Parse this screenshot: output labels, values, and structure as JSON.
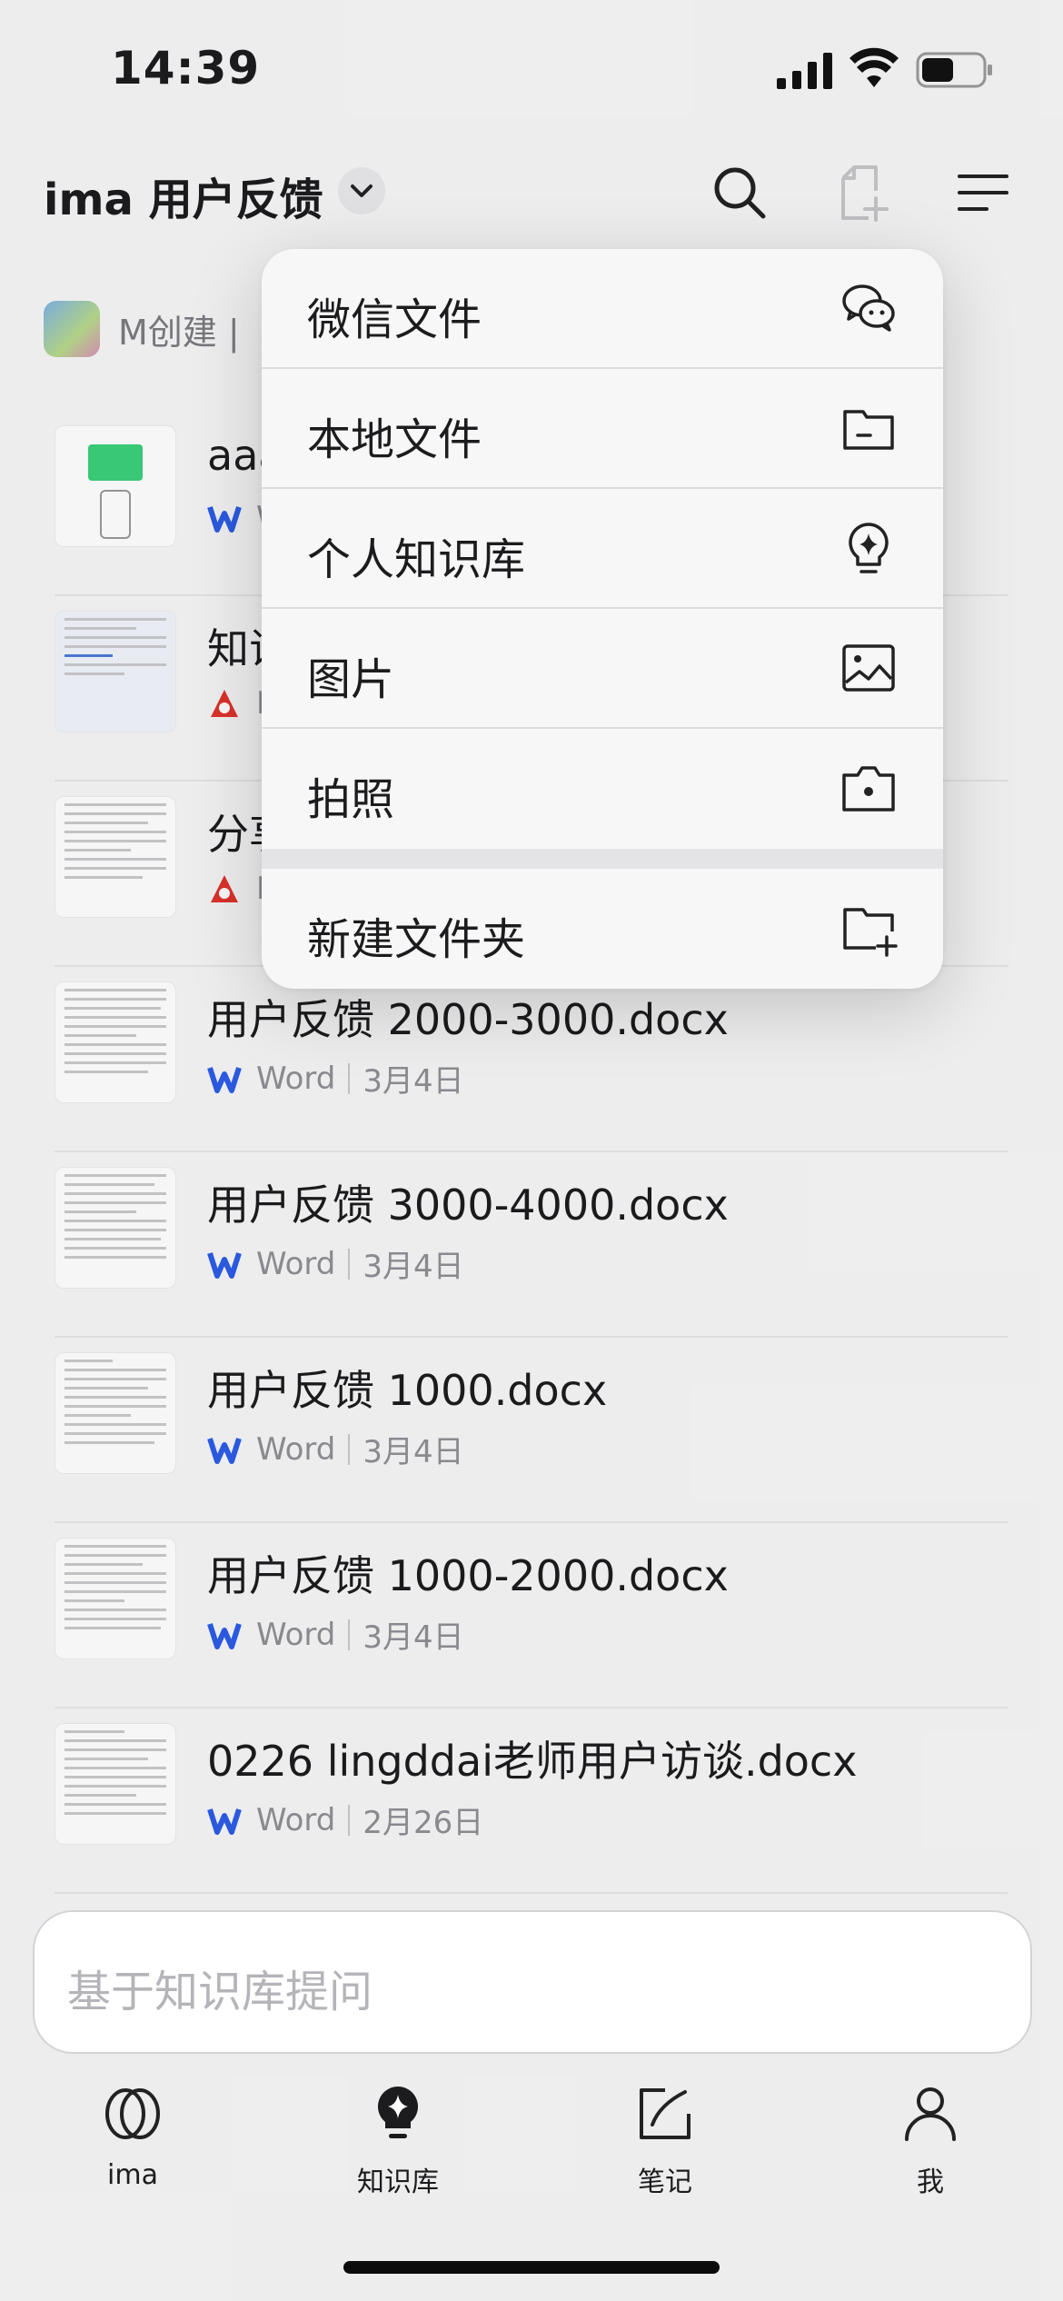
{
  "status_bar": {
    "time": "14:39"
  },
  "header": {
    "title": "ima 用户反馈"
  },
  "creator": {
    "text": "M创建 |"
  },
  "files": [
    {
      "name": "aaa",
      "type": "Word",
      "date": ""
    },
    {
      "name": "知识",
      "type": "PDF",
      "date": ""
    },
    {
      "name": "分享",
      "type": "PDF",
      "date": ""
    },
    {
      "name": "用户反馈 2000-3000.docx",
      "type": "Word",
      "date": "3月4日"
    },
    {
      "name": "用户反馈 3000-4000.docx",
      "type": "Word",
      "date": "3月4日"
    },
    {
      "name": "用户反馈 1000.docx",
      "type": "Word",
      "date": "3月4日"
    },
    {
      "name": "用户反馈 1000-2000.docx",
      "type": "Word",
      "date": "3月4日"
    },
    {
      "name": "0226 lingddai老师用户访谈.docx",
      "type": "Word",
      "date": "2月26日"
    }
  ],
  "menu": {
    "items": [
      {
        "label": "微信文件",
        "icon": "wechat-icon"
      },
      {
        "label": "本地文件",
        "icon": "folder-icon"
      },
      {
        "label": "个人知识库",
        "icon": "knowledge-bulb-icon"
      },
      {
        "label": "图片",
        "icon": "image-icon"
      },
      {
        "label": "拍照",
        "icon": "camera-icon"
      },
      {
        "label": "新建文件夹",
        "icon": "new-folder-icon"
      }
    ]
  },
  "ask": {
    "placeholder": "基于知识库提问"
  },
  "tabs": [
    {
      "label": "ima",
      "icon": "ima-logo-icon"
    },
    {
      "label": "知识库",
      "icon": "knowledge-bulb-icon"
    },
    {
      "label": "笔记",
      "icon": "note-icon"
    },
    {
      "label": "我",
      "icon": "person-icon"
    }
  ],
  "colors": {
    "word_blue": "#2b5ce6",
    "pdf_red": "#e0322b",
    "text": "#1c1c1e",
    "muted": "#8e8e93"
  }
}
